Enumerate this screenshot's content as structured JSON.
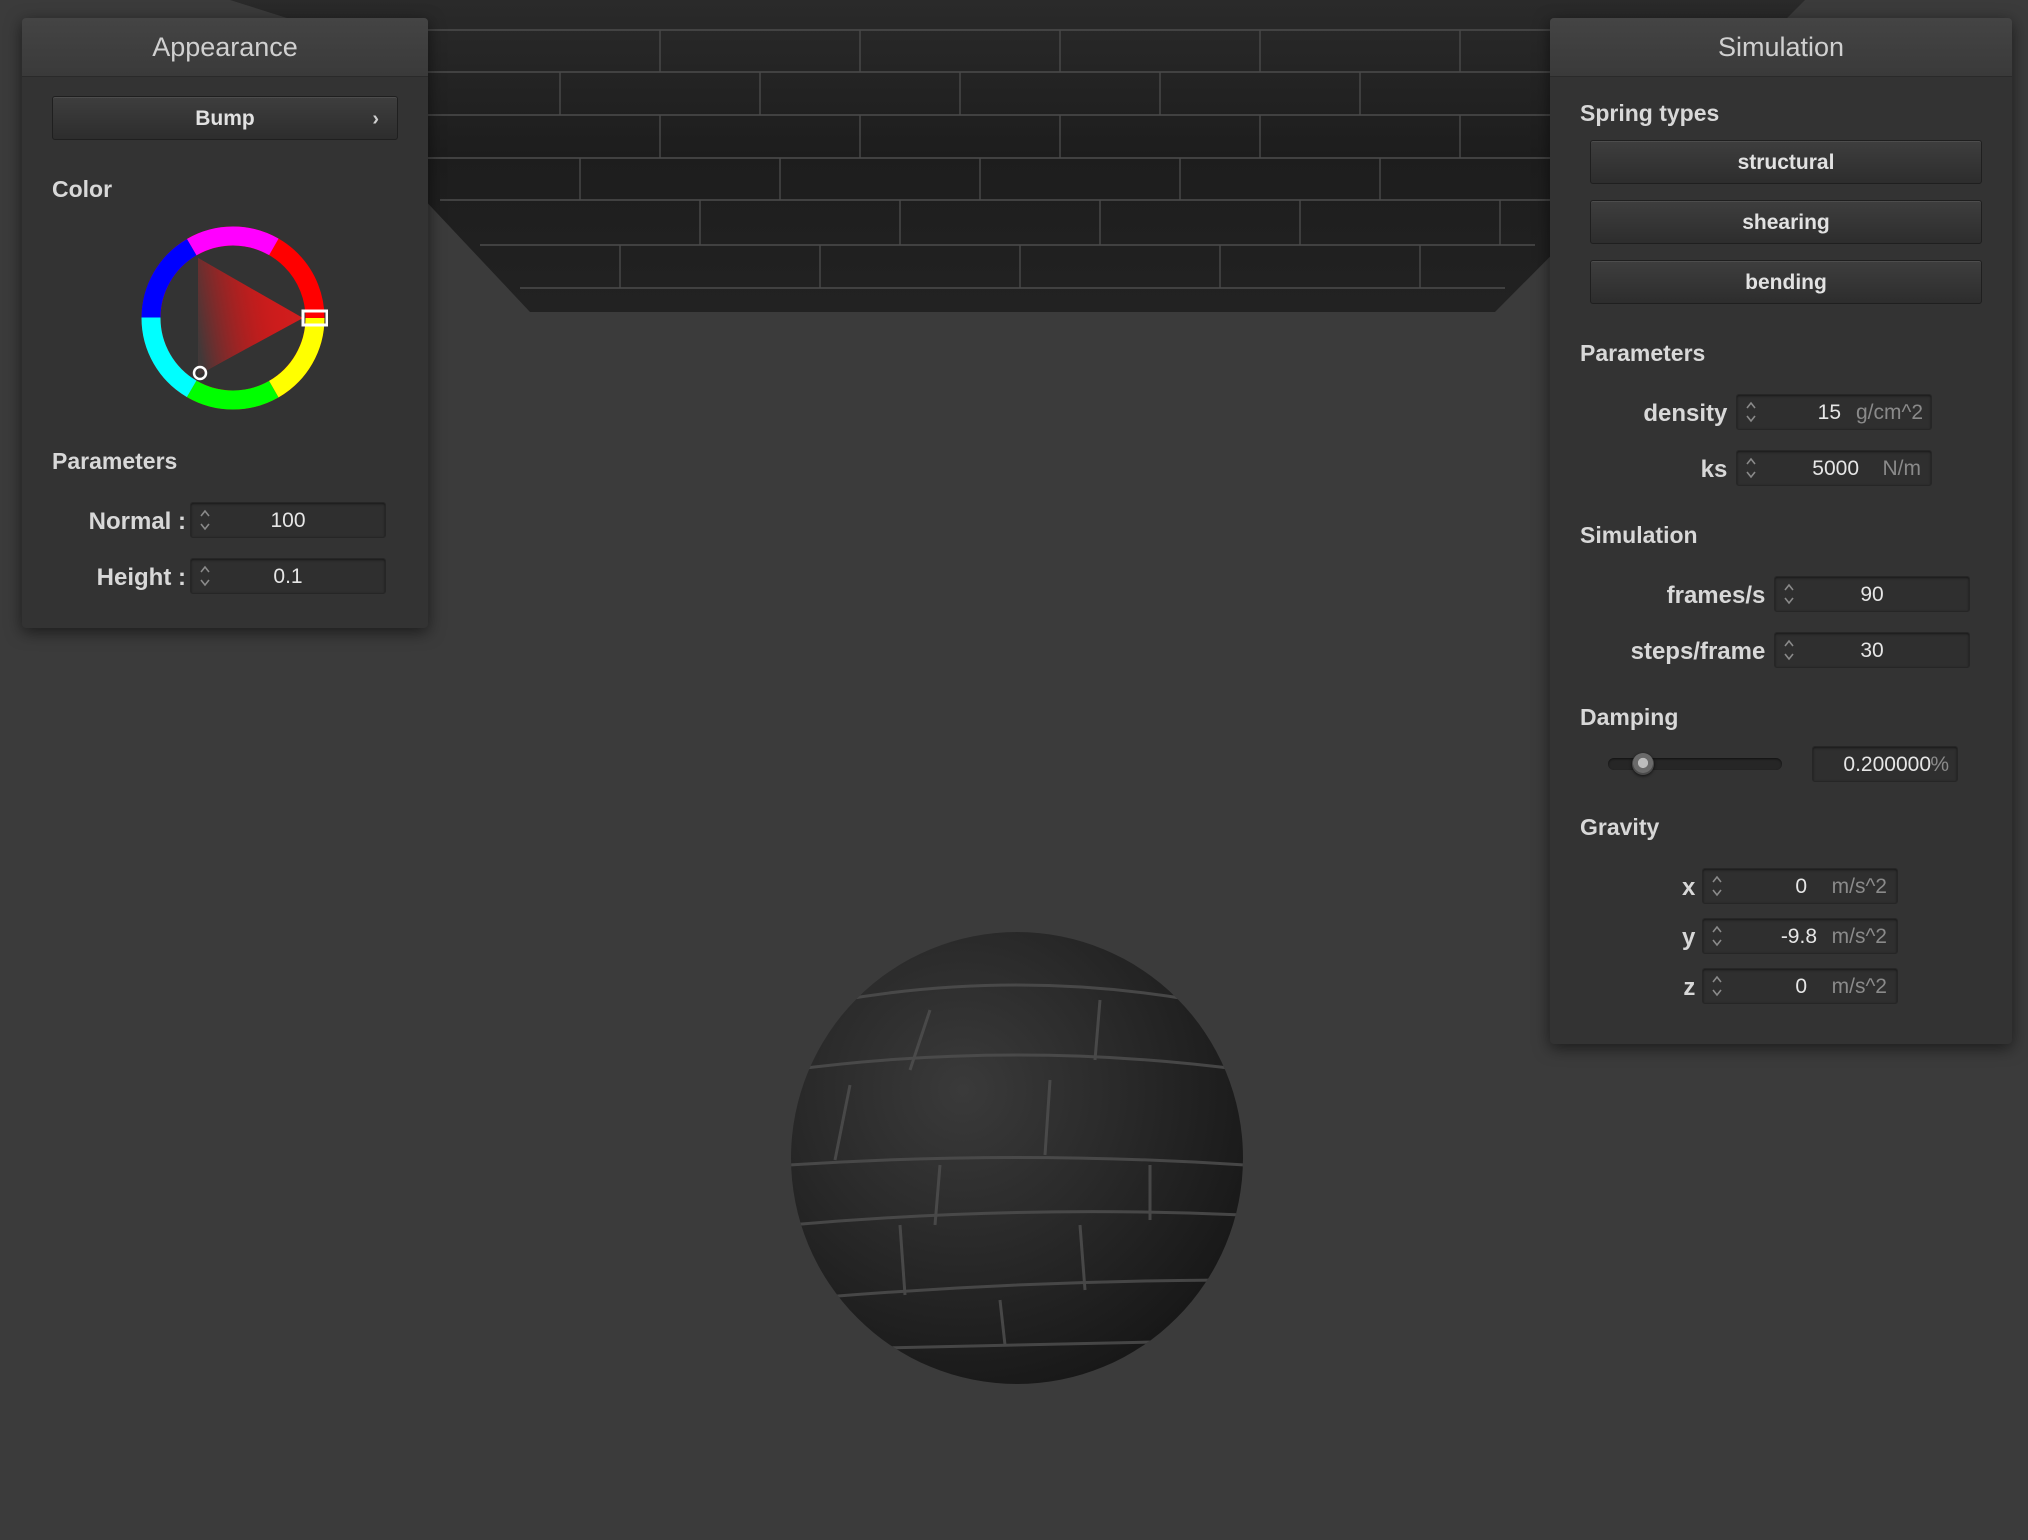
{
  "appearance": {
    "title": "Appearance",
    "shader_button_label": "Bump",
    "shader_button_chevron": "›",
    "color_section": "Color",
    "params_section": "Parameters",
    "normal": {
      "label": "Normal :",
      "value": "100"
    },
    "height": {
      "label": "Height :",
      "value": "0.1"
    },
    "color_hue": "#ff0000"
  },
  "simulation": {
    "title": "Simulation",
    "spring_types_section": "Spring types",
    "spring_types": [
      "structural",
      "shearing",
      "bending"
    ],
    "params_section": "Parameters",
    "density": {
      "label": "density :",
      "value": "15",
      "unit": "g/cm^2"
    },
    "ks": {
      "label": "ks :",
      "value": "5000",
      "unit": "N/m"
    },
    "sim_section": "Simulation",
    "frames": {
      "label": "frames/s :",
      "value": "90"
    },
    "steps": {
      "label": "steps/frame :",
      "value": "30"
    },
    "damping_section": "Damping",
    "damping": {
      "value": "0.200000",
      "unit": "%",
      "slider_fraction": 0.2
    },
    "gravity_section": "Gravity",
    "gravity": {
      "x": {
        "label": "x :",
        "value": "0",
        "unit": "m/s^2"
      },
      "y": {
        "label": "y :",
        "value": "-9.8",
        "unit": "m/s^2"
      },
      "z": {
        "label": "z :",
        "value": "0",
        "unit": "m/s^2"
      }
    }
  },
  "colors": {
    "background": "#3b3b3b",
    "panel": "#333333",
    "cloth": "#1c1c1c",
    "sphere": "#262626"
  }
}
